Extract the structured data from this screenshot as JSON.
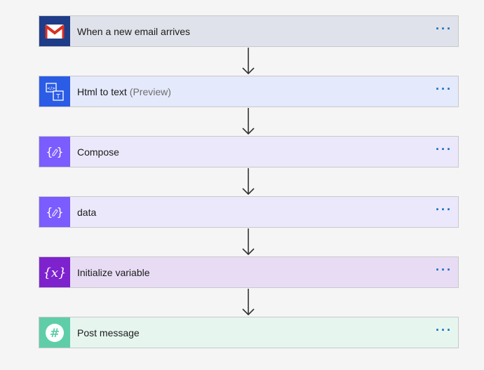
{
  "steps": [
    {
      "id": "email",
      "label": "When a new email arrives",
      "suffix": "",
      "icon": "gmail-icon",
      "bg": "#dfe2ea",
      "iconBg": "#1f3c88"
    },
    {
      "id": "html",
      "label": "Html to text",
      "suffix": "(Preview)",
      "icon": "html-to-text-icon",
      "bg": "#e4e9fb",
      "iconBg": "#2b5ce6"
    },
    {
      "id": "compose",
      "label": "Compose",
      "suffix": "",
      "icon": "compose-icon",
      "bg": "#ece8fb",
      "iconBg": "#7b5cff"
    },
    {
      "id": "data",
      "label": "data",
      "suffix": "",
      "icon": "compose-icon",
      "bg": "#ece8fb",
      "iconBg": "#7b5cff"
    },
    {
      "id": "init",
      "label": "Initialize variable",
      "suffix": "",
      "icon": "variable-icon",
      "bg": "#e8dcf5",
      "iconBg": "#7e22ce"
    },
    {
      "id": "slack",
      "label": "Post message",
      "suffix": "",
      "icon": "slack-icon",
      "bg": "#e6f6ef",
      "iconBg": "#5fcea8"
    }
  ],
  "more_label": "···",
  "colors": {
    "accent": "#0f6cbd",
    "arrow": "#333333"
  }
}
